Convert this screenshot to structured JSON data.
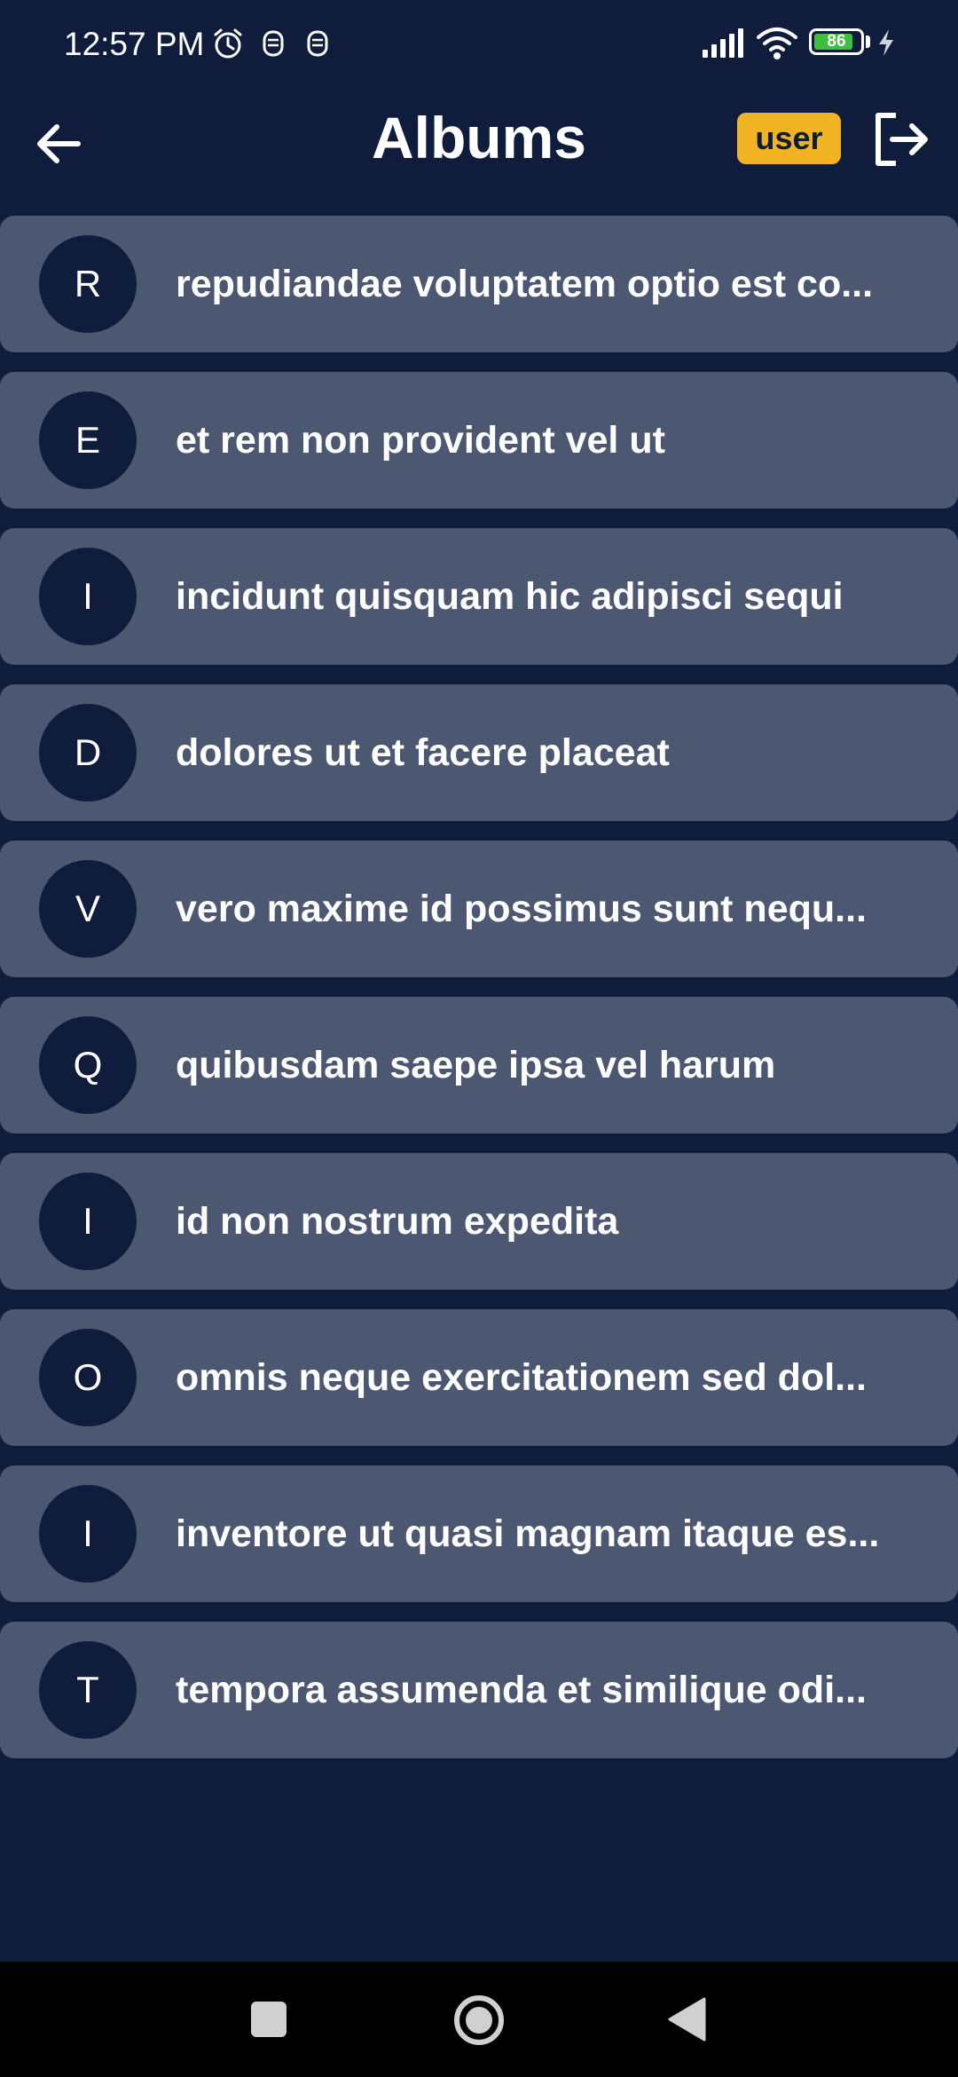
{
  "status_bar": {
    "time": "12:57 PM",
    "battery_level": "86",
    "battery_fraction": 0.86,
    "icons": [
      "alarm-icon",
      "notification-icon",
      "notification-icon",
      "signal-icon",
      "wifi-icon",
      "battery-icon",
      "charging-icon"
    ]
  },
  "header": {
    "back_icon": "arrow-left-icon",
    "title": "Albums",
    "role_badge": "user",
    "logout_icon": "logout-icon"
  },
  "albums": [
    {
      "initial": "R",
      "title": "repudiandae voluptatem optio est co..."
    },
    {
      "initial": "E",
      "title": "et rem non provident vel ut"
    },
    {
      "initial": "I",
      "title": "incidunt quisquam hic adipisci sequi"
    },
    {
      "initial": "D",
      "title": "dolores ut et facere placeat"
    },
    {
      "initial": "V",
      "title": "vero maxime id possimus sunt nequ..."
    },
    {
      "initial": "Q",
      "title": "quibusdam saepe ipsa vel harum"
    },
    {
      "initial": "I",
      "title": "id non nostrum expedita"
    },
    {
      "initial": "O",
      "title": "omnis neque exercitationem sed dol..."
    },
    {
      "initial": "I",
      "title": "inventore ut quasi magnam itaque es..."
    },
    {
      "initial": "T",
      "title": "tempora assumenda et similique odi..."
    }
  ],
  "nav_bar": {
    "buttons": [
      "recents-icon",
      "home-icon",
      "back-icon"
    ]
  },
  "colors": {
    "background": "#0f1c3c",
    "card": "#4c5871",
    "badge": "#f0b323",
    "battery": "#3fbf3f"
  }
}
